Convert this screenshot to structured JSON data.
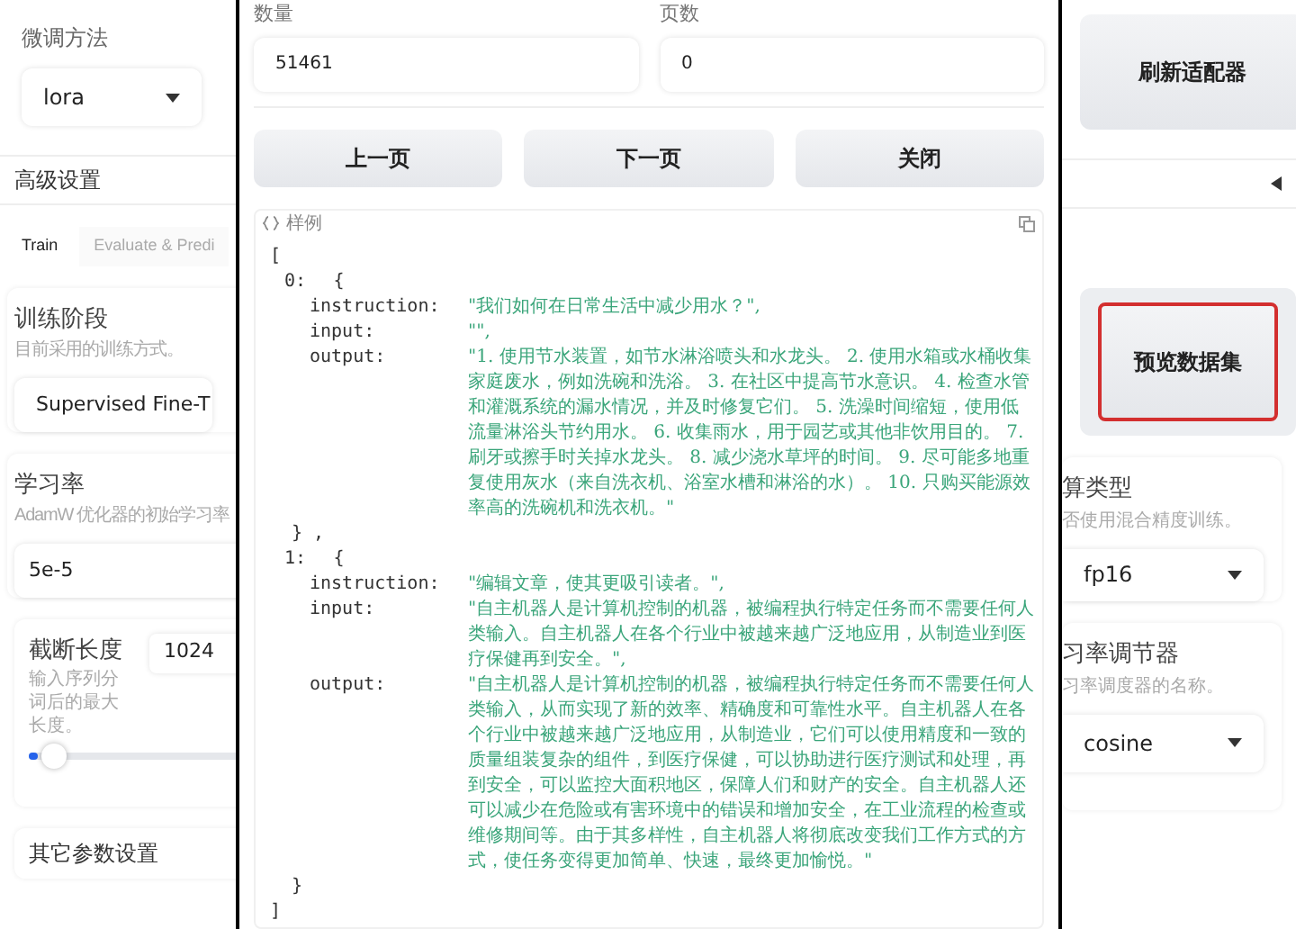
{
  "left_panel": {
    "finetune_method": {
      "label": "微调方法",
      "value": "lora"
    },
    "advanced_settings": {
      "title": "高级设置"
    },
    "tabs": [
      {
        "label": "Train",
        "selected": true
      },
      {
        "label": "Evaluate & Predi",
        "selected": false
      }
    ],
    "training_stage": {
      "label": "训练阶段",
      "hint": "目前采用的训练方式。",
      "value": "Supervised Fine-T"
    },
    "learning_rate": {
      "label": "学习率",
      "hint": "AdamW 优化器的初始学习率",
      "value": "5e-5"
    },
    "cutoff_length": {
      "label": "截断长度",
      "hint": "输入序列分词后的最大长度。",
      "value": "1024",
      "level": 0.03
    },
    "other_settings": {
      "title": "其它参数设置"
    }
  },
  "preview": {
    "count": {
      "label": "数量",
      "value": "51461"
    },
    "page": {
      "label": "页数",
      "value": "0"
    },
    "buttons": [
      "上一页",
      "下一页",
      "关闭"
    ],
    "sample_label": "样例",
    "open": "[",
    "close": "]",
    "entries": [
      {
        "index": "0:",
        "open": "{",
        "close": "} ,",
        "fields": [
          {
            "key": "instruction:",
            "value": "\"我们如何在日常生活中减少用水？\","
          },
          {
            "key": "input:",
            "value": "\"\","
          },
          {
            "key": "output:",
            "value": "\"1. 使用节水装置，如节水淋浴喷头和水龙头。 2. 使用水箱或水桶收集家庭废水，例如洗碗和洗浴。 3. 在社区中提高节水意识。 4. 检查水管和灌溉系统的漏水情况，并及时修复它们。 5. 洗澡时间缩短，使用低流量淋浴头节约用水。 6. 收集雨水，用于园艺或其他非饮用目的。 7. 刷牙或擦手时关掉水龙头。 8. 减少浇水草坪的时间。 9. 尽可能多地重复使用灰水（来自洗衣机、浴室水槽和淋浴的水）。 10. 只购买能源效率高的洗碗机和洗衣机。\""
          }
        ]
      },
      {
        "index": "1:",
        "open": "{",
        "close": "}",
        "fields": [
          {
            "key": "instruction:",
            "value": "\"编辑文章，使其更吸引读者。\","
          },
          {
            "key": "input:",
            "value": "\"自主机器人是计算机控制的机器，被编程执行特定任务而不需要任何人类输入。自主机器人在各个行业中被越来越广泛地应用，从制造业到医疗保健再到安全。\","
          },
          {
            "key": "output:",
            "value": "\"自主机器人是计算机控制的机器，被编程执行特定任务而不需要任何人类输入，从而实现了新的效率、精确度和可靠性水平。自主机器人在各个行业中被越来越广泛地应用，从制造业，它们可以使用精度和一致的质量组装复杂的组件，到医疗保健，可以协助进行医疗测试和处理，再到安全，可以监控大面积地区，保障人们和财产的安全。自主机器人还可以减少在危险或有害环境中的错误和增加安全，在工业流程的检查或维修期间等。由于其多样性，自主机器人将彻底改变我们工作方式的方式，使任务变得更加简单、快速，最终更加愉悦。\""
          }
        ]
      }
    ]
  },
  "right_panel": {
    "refresh_button": "刷新适配器",
    "preview_button": {
      "label": "预览数据集",
      "highlighted": true
    },
    "compute_type": {
      "label": "算类型",
      "hint": "否使用混合精度训练。",
      "value": "fp16"
    },
    "lr_scheduler": {
      "label": "习率调节器",
      "hint": "习率调度器的名称。",
      "value": "cosine"
    }
  }
}
